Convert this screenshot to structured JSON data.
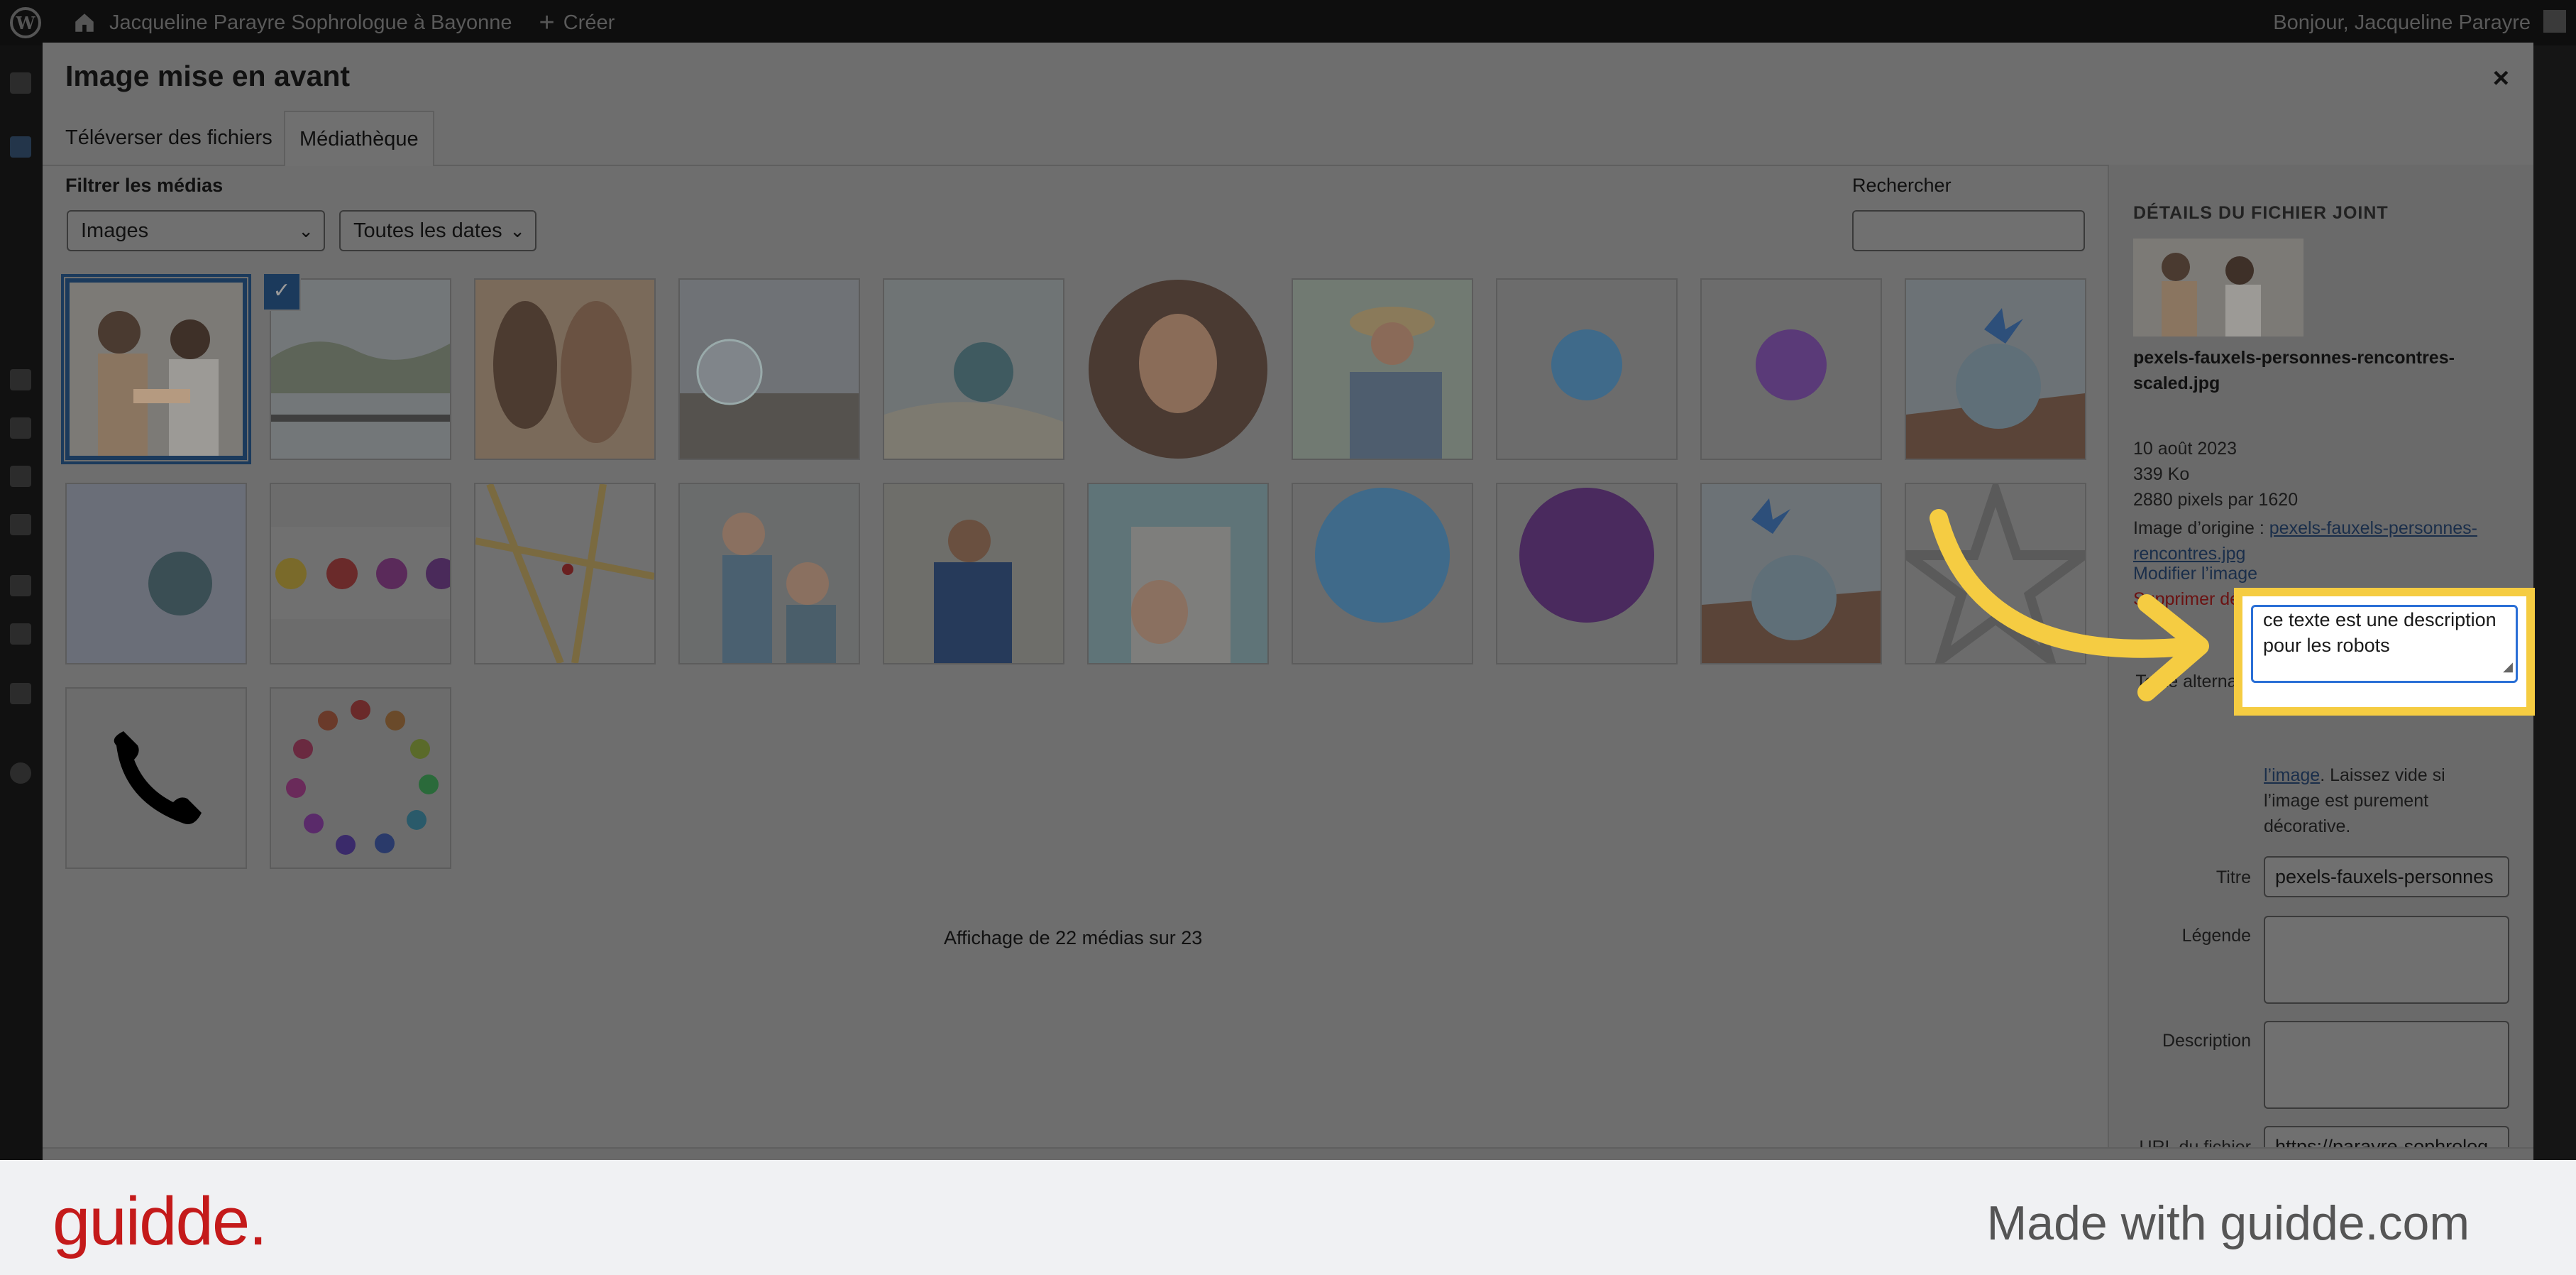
{
  "adminbar": {
    "site_name": "Jacqueline Parayre Sophrologue à Bayonne",
    "create_label": "Créer",
    "greeting": "Bonjour, Jacqueline Parayre"
  },
  "modal": {
    "title": "Image mise en avant",
    "close_label": "×",
    "tabs": [
      {
        "label": "Téléverser des fichiers"
      },
      {
        "label": "Médiathèque"
      }
    ],
    "filter_label": "Filtrer les médias",
    "filter_type": "Images",
    "filter_date": "Toutes les dates",
    "search_label": "Rechercher",
    "search_value": "",
    "count_text": "Affichage de 22 médias sur 23"
  },
  "media": [
    {
      "name": "people-meeting",
      "selected": true
    },
    {
      "name": "rowing-lake"
    },
    {
      "name": "women-profile"
    },
    {
      "name": "crystal-ball-beach"
    },
    {
      "name": "crystal-ball-feather"
    },
    {
      "name": "portrait-round"
    },
    {
      "name": "woman-hat"
    },
    {
      "name": "blue-bubble"
    },
    {
      "name": "purple-bubble"
    },
    {
      "name": "butterfly-globe"
    },
    {
      "name": "crystal-ball-blue"
    },
    {
      "name": "color-spheres"
    },
    {
      "name": "city-map"
    },
    {
      "name": "elderly-exercise"
    },
    {
      "name": "man-relaxing"
    },
    {
      "name": "pregnant-woman"
    },
    {
      "name": "big-blue-bubble"
    },
    {
      "name": "big-purple-bubble"
    },
    {
      "name": "butterfly-globe-2"
    },
    {
      "name": "star-outline"
    },
    {
      "name": "phone-icon"
    },
    {
      "name": "color-circle"
    }
  ],
  "details": {
    "heading": "DÉTAILS DU FICHIER JOINT",
    "filename": "pexels-fauxels-personnes-rencontres-scaled.jpg",
    "date": "10 août 2023",
    "size": "339 Ko",
    "dimensions": "2880 pixels par 1620",
    "origin_label": "Image d’origine :",
    "origin_link": "pexels-fauxels-personnes-rencontres.jpg",
    "edit_link": "Modifier l’image",
    "delete_link": "Supprimer définitivement",
    "alt_label": "Texte alternatif",
    "alt_value": "ce texte est une description pour les robots",
    "help_link": "l’image",
    "help_text": ". Laissez vide si l’image est purement décorative.",
    "title_label": "Titre",
    "title_value": "pexels-fauxels-personnes",
    "caption_label": "Légende",
    "caption_value": "",
    "description_label": "Description",
    "description_value": "",
    "url_label": "URL du fichier :",
    "url_value": "https://parayre-sophrolog"
  },
  "banner": {
    "logo": "guidde.",
    "made_with": "Made with guidde.com"
  },
  "colors": {
    "highlight": "#f5cc42",
    "brand_red": "#c41a1a",
    "overlay_modal": "#6e6e6e"
  }
}
